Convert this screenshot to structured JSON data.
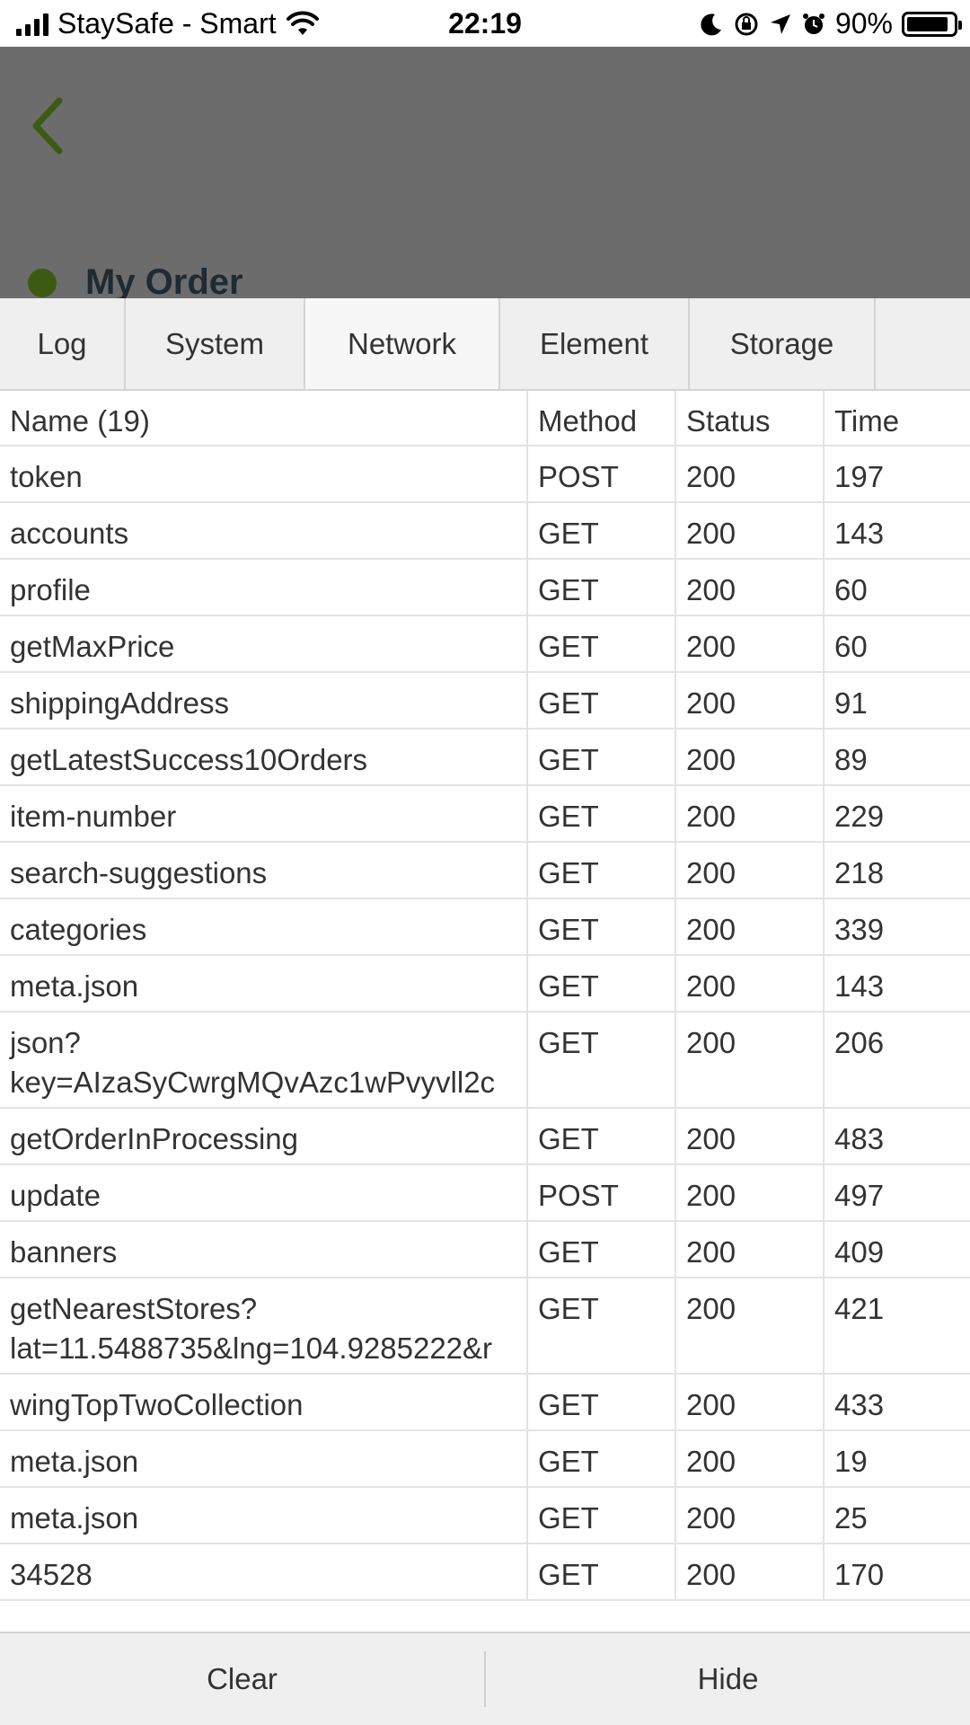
{
  "statusbar": {
    "carrier": "StaySafe - Smart",
    "time": "22:19",
    "battery": "90%",
    "battery_level": 0.9
  },
  "header": {
    "title": "My Order",
    "back_icon": "chevron-left-icon",
    "accent_color": "#3d5a14"
  },
  "tabs": [
    {
      "label": "Log",
      "active": false
    },
    {
      "label": "System",
      "active": false
    },
    {
      "label": "Network",
      "active": true
    },
    {
      "label": "Element",
      "active": false
    },
    {
      "label": "Storage",
      "active": false
    }
  ],
  "table": {
    "columns": [
      "Name (19)",
      "Method",
      "Status",
      "Time"
    ],
    "rows": [
      {
        "name": "token",
        "method": "POST",
        "status": "200",
        "time": "197"
      },
      {
        "name": "accounts",
        "method": "GET",
        "status": "200",
        "time": "143"
      },
      {
        "name": "profile",
        "method": "GET",
        "status": "200",
        "time": "60"
      },
      {
        "name": "getMaxPrice",
        "method": "GET",
        "status": "200",
        "time": "60"
      },
      {
        "name": "shippingAddress",
        "method": "GET",
        "status": "200",
        "time": "91"
      },
      {
        "name": "getLatestSuccess10Orders",
        "method": "GET",
        "status": "200",
        "time": "89"
      },
      {
        "name": "item-number",
        "method": "GET",
        "status": "200",
        "time": "229"
      },
      {
        "name": "search-suggestions",
        "method": "GET",
        "status": "200",
        "time": "218"
      },
      {
        "name": "categories",
        "method": "GET",
        "status": "200",
        "time": "339"
      },
      {
        "name": "meta.json",
        "method": "GET",
        "status": "200",
        "time": "143"
      },
      {
        "name": "json?\nkey=AIzaSyCwrgMQvAzc1wPvyvll2c",
        "method": "GET",
        "status": "200",
        "time": "206"
      },
      {
        "name": "getOrderInProcessing",
        "method": "GET",
        "status": "200",
        "time": "483"
      },
      {
        "name": "update",
        "method": "POST",
        "status": "200",
        "time": "497"
      },
      {
        "name": "banners",
        "method": "GET",
        "status": "200",
        "time": "409"
      },
      {
        "name": "getNearestStores?\nlat=11.5488735&lng=104.9285222&r",
        "method": "GET",
        "status": "200",
        "time": "421"
      },
      {
        "name": "wingTopTwoCollection",
        "method": "GET",
        "status": "200",
        "time": "433"
      },
      {
        "name": "meta.json",
        "method": "GET",
        "status": "200",
        "time": "19"
      },
      {
        "name": "meta.json",
        "method": "GET",
        "status": "200",
        "time": "25"
      },
      {
        "name": "34528",
        "method": "GET",
        "status": "200",
        "time": "170"
      }
    ]
  },
  "footer": {
    "clear_label": "Clear",
    "hide_label": "Hide"
  }
}
